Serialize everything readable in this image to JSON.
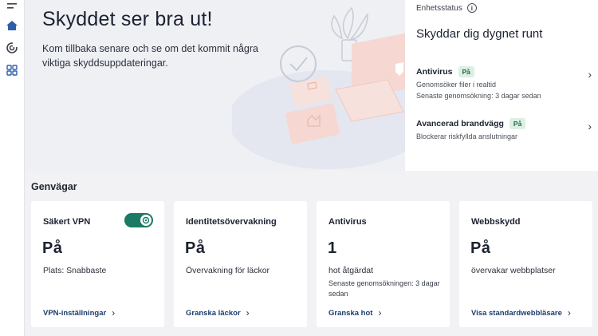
{
  "hero": {
    "title": "Skyddet ser bra ut!",
    "subtitle": "Kom tillbaka senare och se om det kommit några viktiga skyddsuppdateringar."
  },
  "device_status": {
    "header": "Enhetsstatus",
    "title": "Skyddar dig dygnet runt",
    "items": [
      {
        "name": "Antivirus",
        "badge": "På",
        "lines": [
          "Genomsöker filer i realtid",
          "Senaste genomsökning: 3 dagar sedan"
        ]
      },
      {
        "name": "Avancerad brandvägg",
        "badge": "På",
        "lines": [
          "Blockerar riskfyllda anslutningar"
        ]
      }
    ]
  },
  "shortcuts": {
    "title": "Genvägar",
    "cards": [
      {
        "title": "Säkert VPN",
        "value": "På",
        "line": "Plats: Snabbaste",
        "extra": "",
        "link": "VPN-inställningar",
        "toggle_on": true
      },
      {
        "title": "Identitetsövervakning",
        "value": "På",
        "line": "Övervakning för läckor",
        "extra": "",
        "link": "Granska läckor"
      },
      {
        "title": "Antivirus",
        "value": "1",
        "line": "hot åtgärdat",
        "extra": "Senaste genomsökningen: 3 dagar sedan",
        "link": "Granska hot"
      },
      {
        "title": "Webbskydd",
        "value": "På",
        "line": "övervakar webbplatser",
        "extra": "",
        "link": "Visa standardwebbläsare"
      }
    ]
  },
  "colors": {
    "accent": "#1b7a63",
    "link": "#1a3d6e",
    "badge_bg": "#dcefe3",
    "nav_active": "#2f5ea8"
  },
  "icons": {
    "nav": [
      "menu-icon",
      "home-icon",
      "scan-icon",
      "apps-grid-icon"
    ]
  }
}
